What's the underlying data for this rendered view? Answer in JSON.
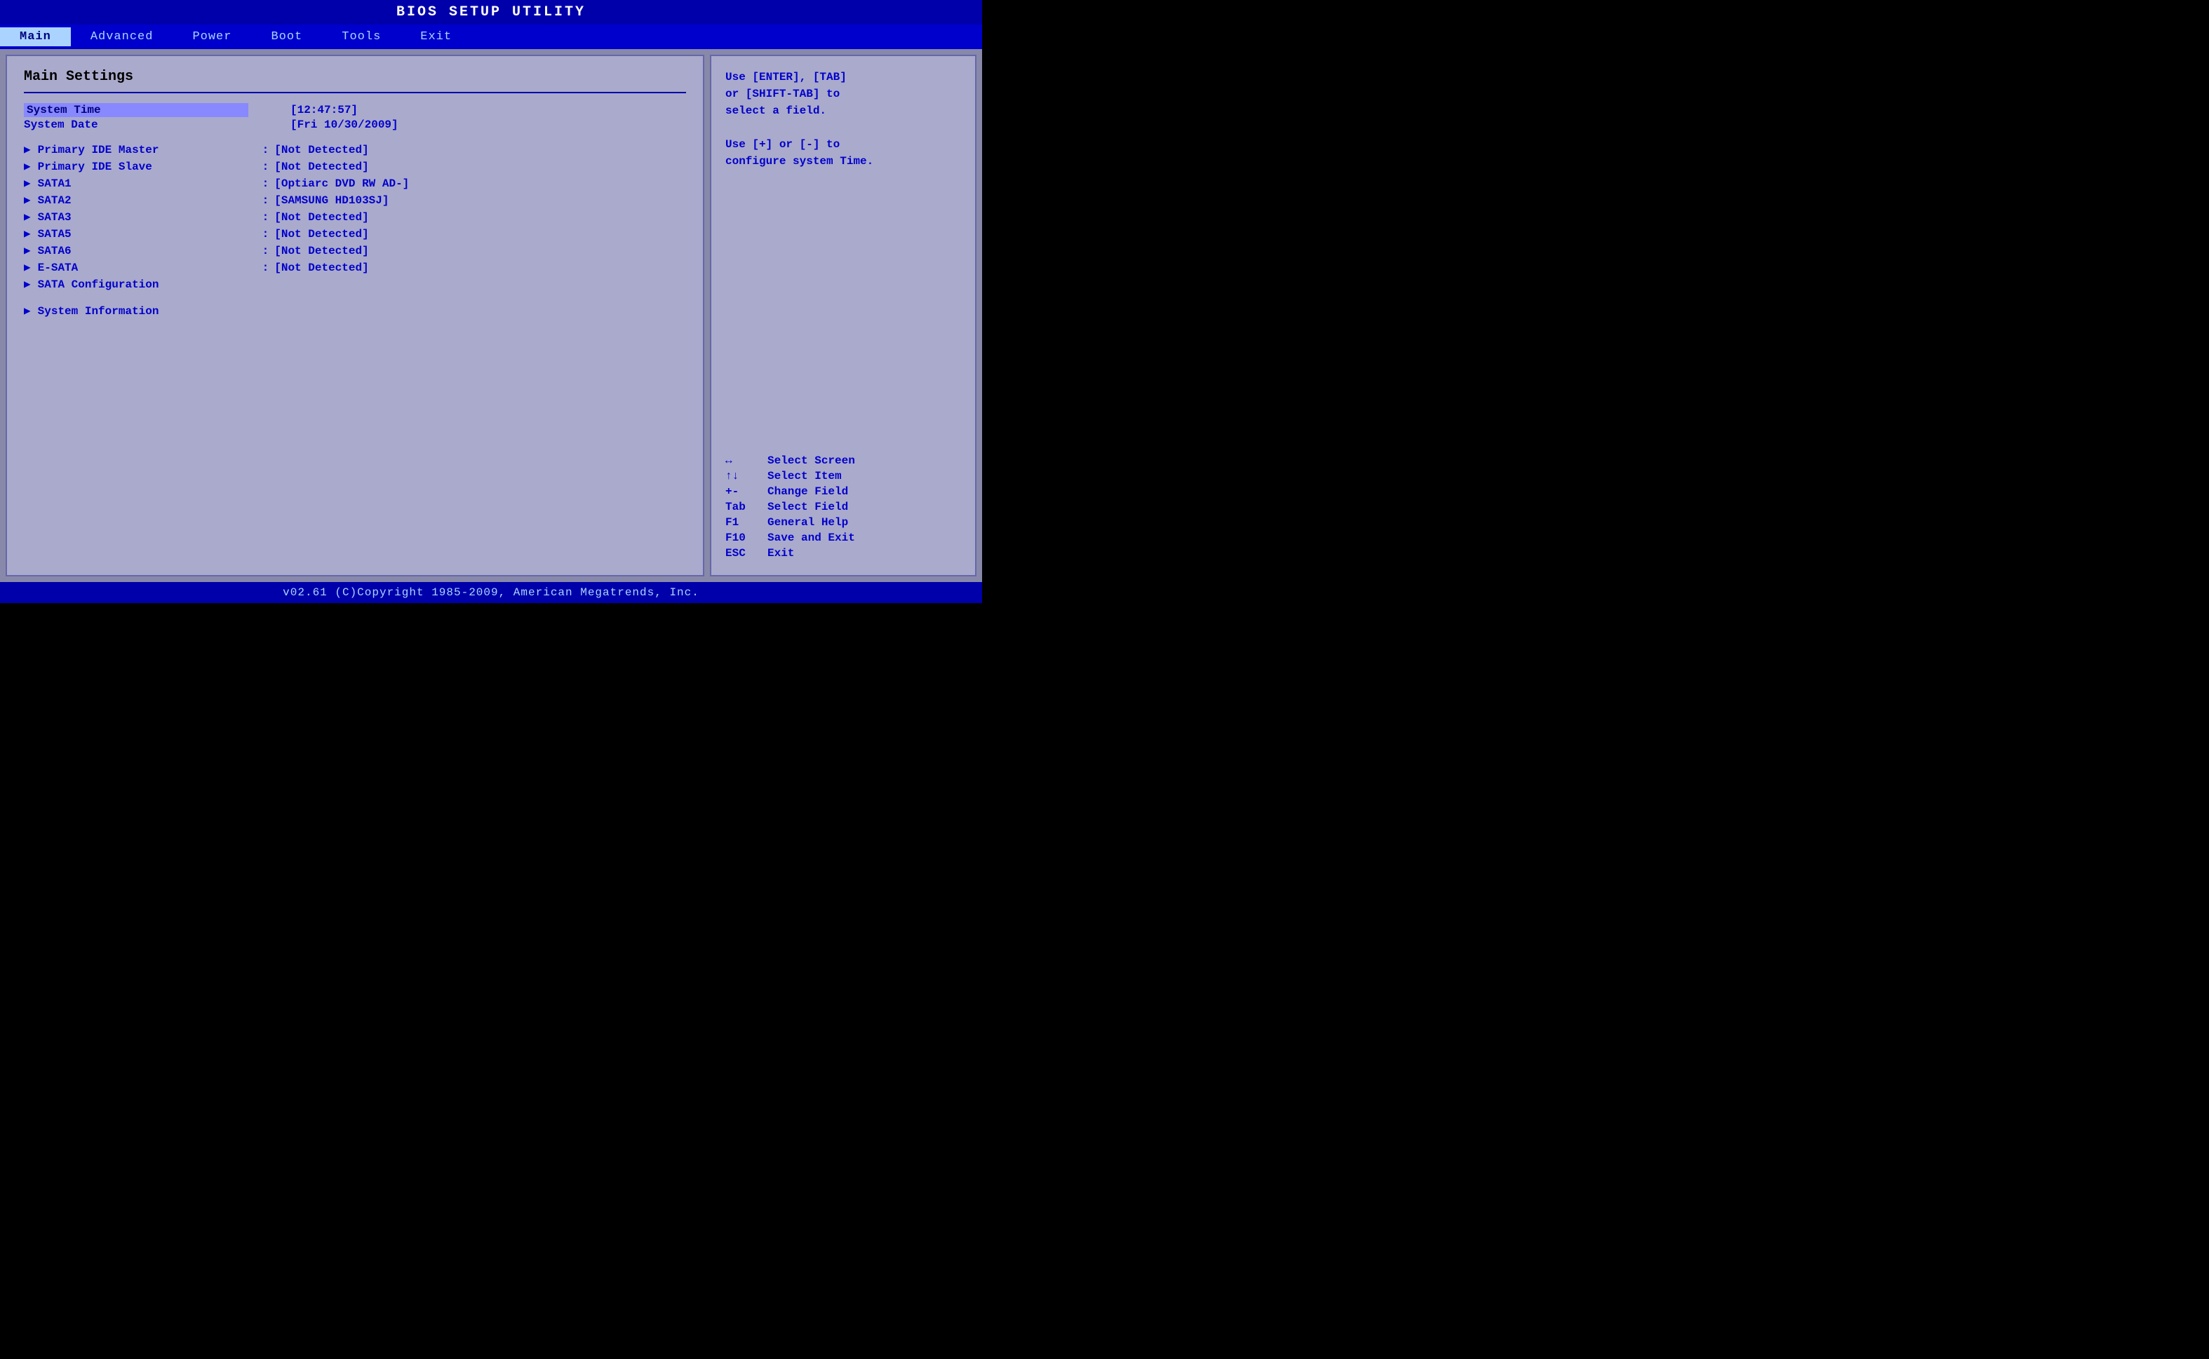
{
  "title_bar": {
    "text": "BIOS  SETUP  UTILITY"
  },
  "menu_bar": {
    "items": [
      {
        "label": "Main",
        "active": true
      },
      {
        "label": "Advanced",
        "active": false
      },
      {
        "label": "Power",
        "active": false
      },
      {
        "label": "Boot",
        "active": false
      },
      {
        "label": "Tools",
        "active": false
      },
      {
        "label": "Exit",
        "active": false
      }
    ]
  },
  "left_panel": {
    "title": "Main Settings",
    "system_time_label": "System Time",
    "system_time_value": "[12:47:57]",
    "system_date_label": "System Date",
    "system_date_value": "[Fri 10/30/2009]",
    "items": [
      {
        "label": "Primary IDE Master",
        "value": "[Not Detected]"
      },
      {
        "label": "Primary IDE Slave",
        "value": "[Not Detected]"
      },
      {
        "label": "SATA1",
        "value": "[Optiarc DVD RW AD-]"
      },
      {
        "label": "SATA2",
        "value": "[SAMSUNG HD103SJ]"
      },
      {
        "label": "SATA3",
        "value": "[Not Detected]"
      },
      {
        "label": "SATA5",
        "value": "[Not Detected]"
      },
      {
        "label": "SATA6",
        "value": "[Not Detected]"
      },
      {
        "label": "E-SATA",
        "value": "[Not Detected]"
      },
      {
        "label": "SATA Configuration",
        "value": ""
      },
      {
        "label": "System Information",
        "value": ""
      }
    ]
  },
  "right_panel": {
    "help_lines": [
      "Use [ENTER], [TAB]",
      "or [SHIFT-TAB] to",
      "select a field.",
      "",
      "Use [+] or [-] to",
      "configure system Time."
    ],
    "keys": [
      {
        "key": "↔",
        "desc": "Select Screen"
      },
      {
        "key": "↑↓",
        "desc": "Select Item"
      },
      {
        "key": "+-",
        "desc": "Change Field"
      },
      {
        "key": "Tab",
        "desc": "Select Field"
      },
      {
        "key": "F1",
        "desc": "General Help"
      },
      {
        "key": "F10",
        "desc": "Save and Exit"
      },
      {
        "key": "ESC",
        "desc": "Exit"
      }
    ]
  },
  "footer": {
    "text": "v02.61  (C)Copyright 1985-2009, American Megatrends, Inc."
  }
}
